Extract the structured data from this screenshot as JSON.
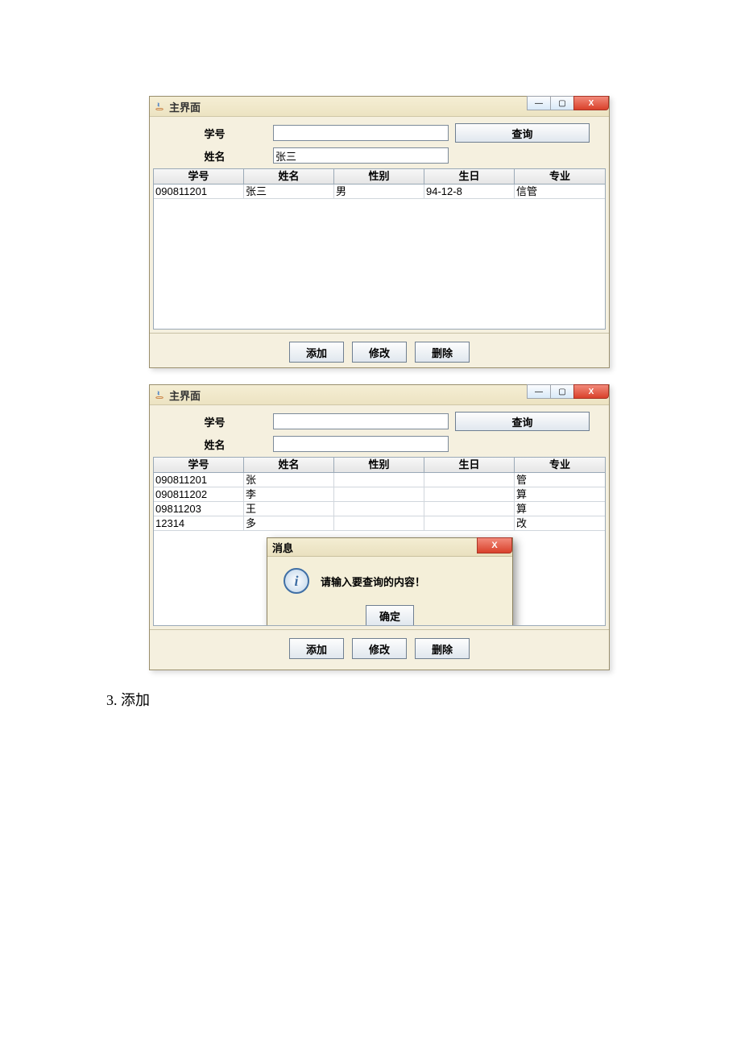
{
  "section": {
    "num": "3.",
    "title": "添加"
  },
  "window1": {
    "title": "主界面",
    "labels": {
      "id": "学号",
      "name": "姓名"
    },
    "inputs": {
      "id": "",
      "name": "张三"
    },
    "query_btn": "查询",
    "columns": [
      "学号",
      "姓名",
      "性别",
      "生日",
      "专业"
    ],
    "rows": [
      {
        "c0": "090811201",
        "c1": "张三",
        "c2": "男",
        "c3": "94-12-8",
        "c4": "信管"
      }
    ],
    "actions": {
      "add": "添加",
      "edit": "修改",
      "del": "删除"
    }
  },
  "window2": {
    "title": "主界面",
    "labels": {
      "id": "学号",
      "name": "姓名"
    },
    "inputs": {
      "id": "",
      "name": ""
    },
    "query_btn": "查询",
    "columns": [
      "学号",
      "姓名",
      "性别",
      "生日",
      "专业"
    ],
    "rows": [
      {
        "c0": "090811201",
        "c1": "张",
        "c4": "管"
      },
      {
        "c0": "090811202",
        "c1": "李",
        "c4": "算"
      },
      {
        "c0": "09811203",
        "c1": "王",
        "c4": "算"
      },
      {
        "c0": "12314",
        "c1": "多",
        "c4": "改"
      }
    ],
    "actions": {
      "add": "添加",
      "edit": "修改",
      "del": "删除"
    },
    "dialog": {
      "title": "消息",
      "message": "请输入要查询的内容！",
      "ok": "确定"
    }
  },
  "win_icons": {
    "min": "—",
    "max": "▢",
    "close": "X"
  }
}
